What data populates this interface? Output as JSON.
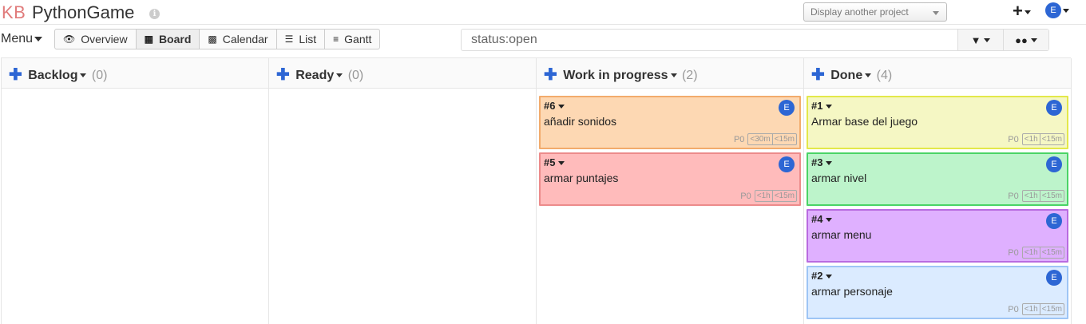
{
  "header": {
    "logo": "KB",
    "title": "PythonGame",
    "info_icon": "info-icon",
    "project_select": "Display another project",
    "plus": "+",
    "avatar": "E"
  },
  "toolbar": {
    "menu_label": "Menu",
    "views": [
      {
        "label": "Overview",
        "icon": "eye-icon"
      },
      {
        "label": "Board",
        "icon": "board-icon"
      },
      {
        "label": "Calendar",
        "icon": "calendar-icon"
      },
      {
        "label": "List",
        "icon": "list-icon"
      },
      {
        "label": "Gantt",
        "icon": "gantt-icon"
      }
    ],
    "active_view": "Board",
    "search_value": "status:open"
  },
  "columns": [
    {
      "title": "Backlog",
      "count": "(0)"
    },
    {
      "title": "Ready",
      "count": "(0)"
    },
    {
      "title": "Work in progress",
      "count": "(2)"
    },
    {
      "title": "Done",
      "count": "(4)"
    }
  ],
  "cards": {
    "wip": [
      {
        "id": "#6",
        "title": "añadir sonidos",
        "owner": "E",
        "priority": "P0",
        "time_est": "<30m",
        "time_spent": "<15m",
        "bg": "#fdd8b3",
        "border": "#f2ab6c"
      },
      {
        "id": "#5",
        "title": "armar puntajes",
        "owner": "E",
        "priority": "P0",
        "time_est": "<1h",
        "time_spent": "<15m",
        "bg": "#ffbbbb",
        "border": "#ec8b8b"
      }
    ],
    "done": [
      {
        "id": "#1",
        "title": "Armar base del juego",
        "owner": "E",
        "priority": "P0",
        "time_est": "<1h",
        "time_spent": "<15m",
        "bg": "#f5f7c4",
        "border": "#e3e84a"
      },
      {
        "id": "#3",
        "title": "armar nivel",
        "owner": "E",
        "priority": "P0",
        "time_est": "<1h",
        "time_spent": "<15m",
        "bg": "#bdf4cb",
        "border": "#4ad466"
      },
      {
        "id": "#4",
        "title": "armar menu",
        "owner": "E",
        "priority": "P0",
        "time_est": "<1h",
        "time_spent": "<15m",
        "bg": "#dfb0ff",
        "border": "#b96be0"
      },
      {
        "id": "#2",
        "title": "armar personaje",
        "owner": "E",
        "priority": "P0",
        "time_est": "<1h",
        "time_spent": "<15m",
        "bg": "#dbebff",
        "border": "#9ec5f5"
      }
    ]
  },
  "colors": {
    "accent": "#2d66d4",
    "logo": "#e07b7b"
  }
}
